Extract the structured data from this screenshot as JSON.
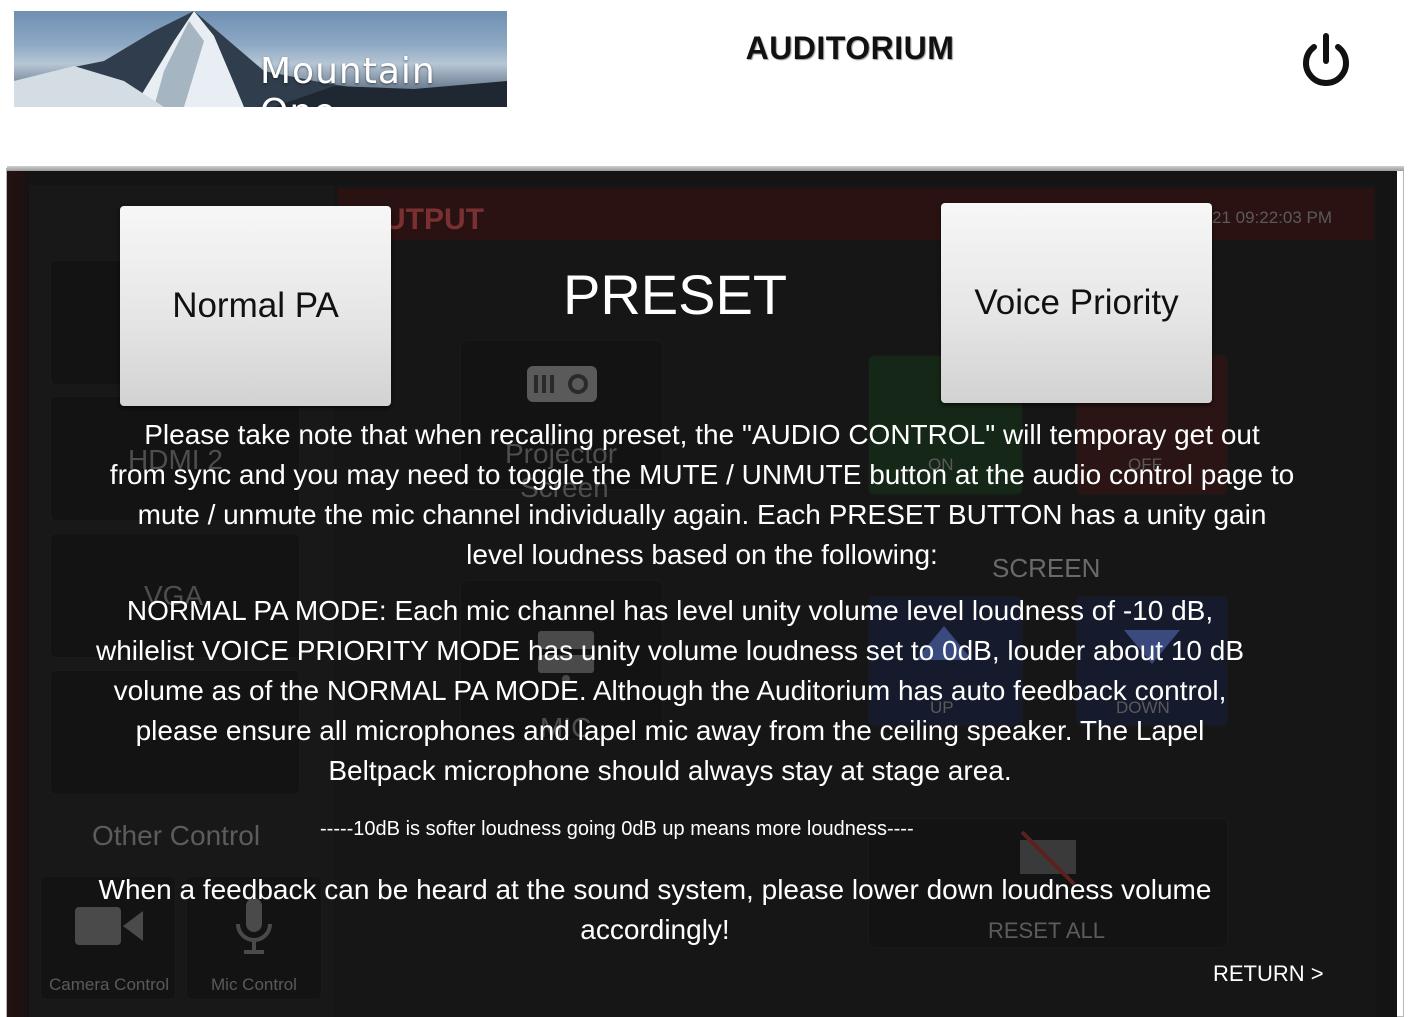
{
  "header": {
    "logo_text": "Mountain One",
    "title": "AUDITORIUM",
    "power_icon": "power-icon"
  },
  "background": {
    "banner_text": "UTPUT",
    "timestamp": "21 09:22:03 PM",
    "hdmi_label": "HDMI 2",
    "vga_label": "VGA",
    "projector_label": "Projector",
    "screen_small_label": "Screen",
    "on_label": "ON",
    "off_label": "OFF",
    "screen_label": "SCREEN",
    "up_label": "UP",
    "down_label": "DOWN",
    "mic_label": "MIC",
    "other_control": "Other Control",
    "reset_all": "RESET ALL",
    "camera_control": "Camera Control",
    "mic_control": "Mic Control"
  },
  "preset": {
    "title": "PRESET",
    "normal_label": "Normal PA",
    "voice_label": "Voice Priority"
  },
  "notes": {
    "para1": [
      "Please take note that when recalling preset,  the \"AUDIO CONTROL\" will temporay get out",
      "from sync and you may need to toggle the MUTE / UNMUTE button at the audio control page to",
      "mute / unmute the mic channel individually again. Each PRESET BUTTON has a unity gain",
      "level loudness based on  the following:"
    ],
    "para2": [
      "NORMAL PA MODE: Each mic channel has level unity volume level loudness of -10 dB,",
      "whilelist VOICE PRIORITY MODE has unity volume loudness  set to 0dB,  louder about 10 dB",
      "volume as of the NORMAL PA MODE. Although the Auditorium has auto feedback control,",
      "please ensure all microphones and lapel mic away from the  ceiling speaker. The Lapel",
      "Beltpack microphone should always stay at stage area."
    ],
    "small_note": "-----10dB is softer loudness going 0dB up means more loudness----",
    "para3": [
      "When a feedback can be heard at the sound system, please lower down loudness volume",
      "accordingly!"
    ]
  },
  "return_label": "RETURN >",
  "colors": {
    "overlay": "#121212",
    "banner": "#6b1515",
    "on_tile": "#1f5f20",
    "off_tile": "#6d1c1c",
    "screen_tiles": "#1f3070"
  }
}
